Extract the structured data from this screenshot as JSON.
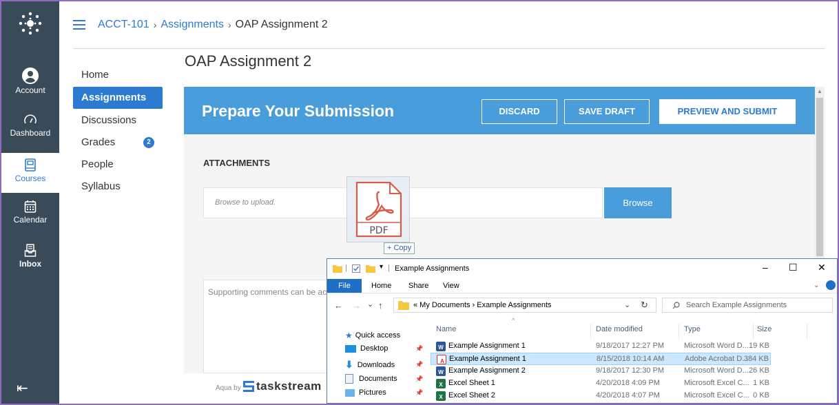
{
  "global_nav": {
    "items": [
      {
        "label": "Account",
        "icon": "account-icon"
      },
      {
        "label": "Dashboard",
        "icon": "dashboard-icon"
      },
      {
        "label": "Courses",
        "icon": "courses-icon"
      },
      {
        "label": "Calendar",
        "icon": "calendar-icon"
      },
      {
        "label": "Inbox",
        "icon": "inbox-icon"
      }
    ],
    "active": "Courses"
  },
  "breadcrumb": {
    "course": "ACCT-101",
    "sep": "›",
    "section": "Assignments",
    "current": "OAP Assignment 2"
  },
  "course_nav": {
    "items": [
      {
        "label": "Home"
      },
      {
        "label": "Assignments"
      },
      {
        "label": "Discussions"
      },
      {
        "label": "Grades",
        "badge": "2"
      },
      {
        "label": "People"
      },
      {
        "label": "Syllabus"
      }
    ]
  },
  "page": {
    "title": "OAP Assignment 2"
  },
  "submission": {
    "header": "Prepare Your Submission",
    "discard_label": "DISCARD",
    "save_draft_label": "SAVE DRAFT",
    "preview_submit_label": "PREVIEW AND SUBMIT",
    "attachments_label": "ATTACHMENTS",
    "upload_placeholder": "Browse to upload.",
    "browse_label": "Browse",
    "comments_placeholder": "Supporting comments can be ac"
  },
  "drag": {
    "file_label": "PDF",
    "copy_label": "+ Copy"
  },
  "footer": {
    "aqua_by": "Aqua by",
    "brand": "taskstream"
  },
  "explorer": {
    "title": "Example Assignments",
    "title_sep": "|",
    "qat_arrow": "▾",
    "controls": {
      "minimize": "–",
      "maximize": "☐",
      "close": "✕"
    },
    "ribbon": {
      "file": "File",
      "tabs": [
        "Home",
        "Share",
        "View"
      ]
    },
    "nav_arrows": {
      "back": "←",
      "forward": "→",
      "recent": "⌄",
      "up": "↑"
    },
    "address": "« My Documents › Example Assignments",
    "address_dropdown": "⌄",
    "refresh": "↻",
    "search_placeholder": "Search Example Assignments",
    "sidebar": [
      "Quick access",
      "Desktop",
      "Downloads",
      "Documents",
      "Pictures"
    ],
    "pin": "📌",
    "columns": {
      "name": "Name",
      "date": "Date modified",
      "type": "Type",
      "size": "Size"
    },
    "sort_indicator": "^",
    "files": [
      {
        "name": "Example Assignment 1",
        "date": "9/18/2017 12:27 PM",
        "type": "Microsoft Word D...",
        "size": "19 KB",
        "kind": "word",
        "kind_glyph": "W"
      },
      {
        "name": "Example Assignment 1",
        "date": "8/15/2018 10:14 AM",
        "type": "Adobe Acrobat D...",
        "size": "384 KB",
        "kind": "pdf",
        "kind_glyph": "A",
        "selected": true
      },
      {
        "name": "Example Assignment 2",
        "date": "9/18/2017 12:30 PM",
        "type": "Microsoft Word D...",
        "size": "26 KB",
        "kind": "word",
        "kind_glyph": "W"
      },
      {
        "name": "Excel Sheet 1",
        "date": "4/20/2018 4:09 PM",
        "type": "Microsoft Excel C...",
        "size": "1 KB",
        "kind": "excel",
        "kind_glyph": "X"
      },
      {
        "name": "Excel Sheet 2",
        "date": "4/20/2018 4:07 PM",
        "type": "Microsoft Excel C...",
        "size": "0 KB",
        "kind": "excel",
        "kind_glyph": "X"
      }
    ]
  },
  "colors": {
    "global_nav_bg": "#394b58",
    "accent": "#2d7bd1",
    "submission_bar": "#4a9ddb",
    "frame": "#8e6bbf",
    "explorer_selected": "#cce8ff"
  }
}
